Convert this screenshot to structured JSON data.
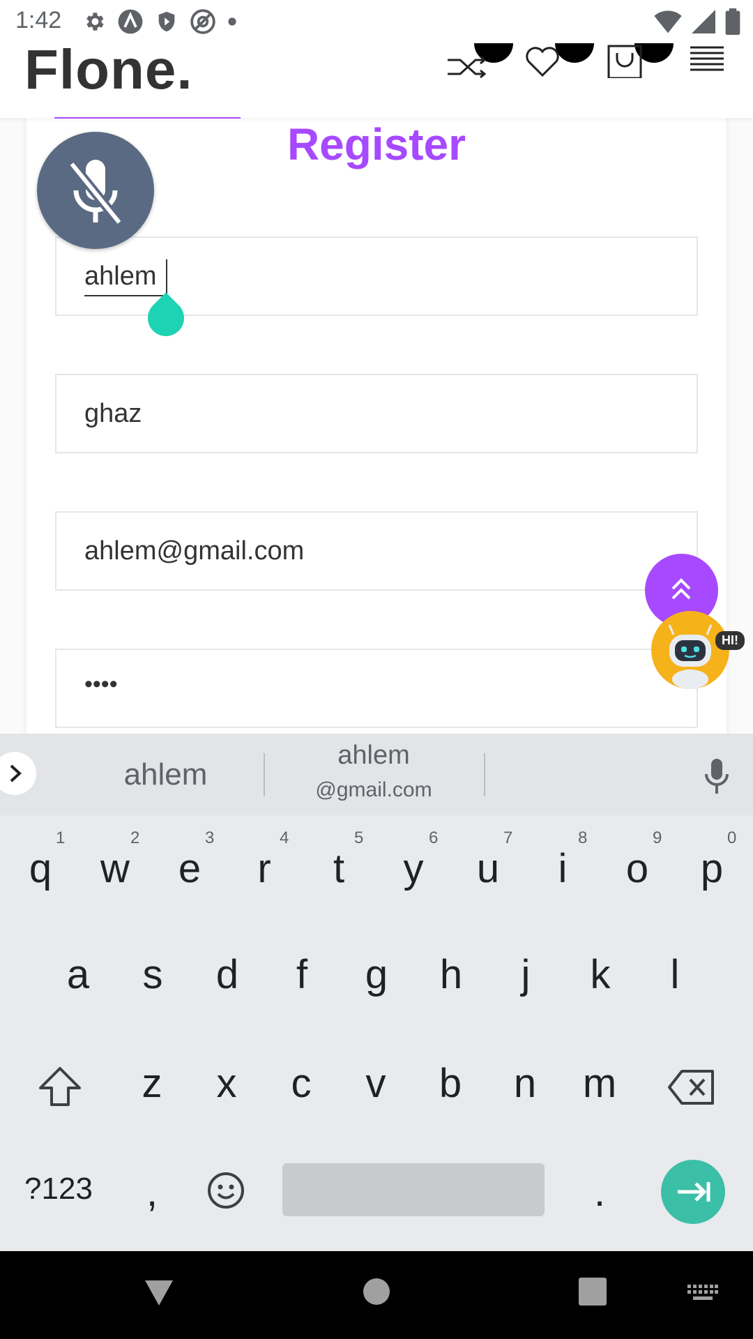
{
  "status_bar": {
    "time": "1:42"
  },
  "header": {
    "logo": "Flone."
  },
  "form": {
    "title": "Register",
    "first_name": "ahlem",
    "last_name": "ghaz",
    "email": "ahlem@gmail.com",
    "password": "••••"
  },
  "chat_widget": {
    "badge": "HI!"
  },
  "keyboard": {
    "suggestions": {
      "left": "ahlem",
      "center_top": "ahlem",
      "center_bottom": "@gmail.com"
    },
    "row1": [
      "q",
      "w",
      "e",
      "r",
      "t",
      "y",
      "u",
      "i",
      "o",
      "p"
    ],
    "row1_hints": [
      "1",
      "2",
      "3",
      "4",
      "5",
      "6",
      "7",
      "8",
      "9",
      "0"
    ],
    "row2": [
      "a",
      "s",
      "d",
      "f",
      "g",
      "h",
      "j",
      "k",
      "l"
    ],
    "row3": [
      "z",
      "x",
      "c",
      "v",
      "b",
      "n",
      "m"
    ],
    "symbols_key": "?123",
    "comma_key": ",",
    "period_key": "."
  },
  "colors": {
    "accent": "#a749ff",
    "enter": "#3bbfa6",
    "mic_fab": "#5a6a82"
  }
}
